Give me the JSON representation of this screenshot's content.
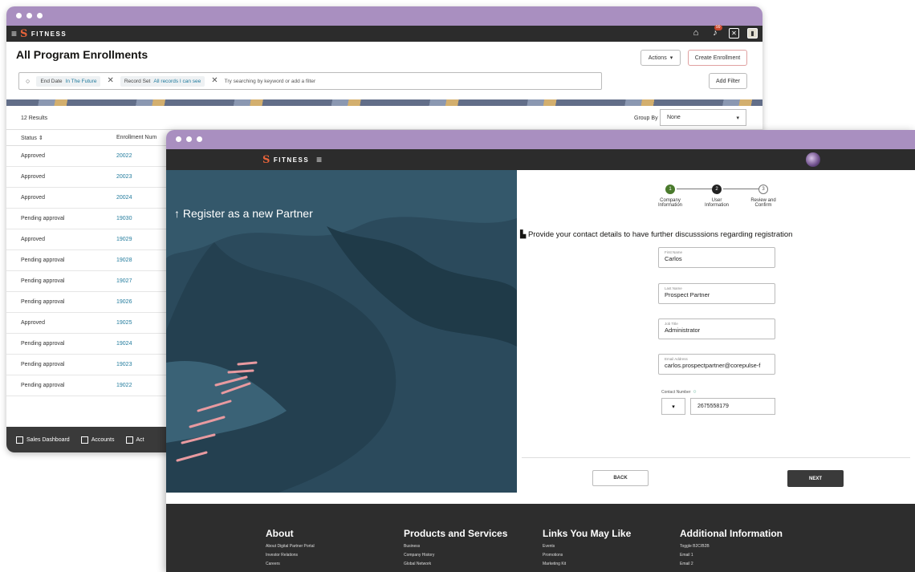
{
  "back_window": {
    "brand": "FITNESS",
    "notification_count": "99",
    "page_title": "All Program Enrollments",
    "actions_label": "Actions",
    "create_label": "Create Enrollment",
    "add_filter_label": "Add Filter",
    "filters": [
      {
        "name": "End Date",
        "value": "In The Future"
      },
      {
        "name": "Record Set",
        "value": "All records I can see"
      }
    ],
    "search_placeholder": "Try searching by keyword or add a filter",
    "results_count": "12 Results",
    "group_by_label": "Group By",
    "group_by_value": "None",
    "columns": [
      "Status",
      "Enrollment Num"
    ],
    "rows": [
      {
        "status": "Approved",
        "number": "20022"
      },
      {
        "status": "Approved",
        "number": "20023"
      },
      {
        "status": "Approved",
        "number": "20024"
      },
      {
        "status": "Pending approval",
        "number": "19030"
      },
      {
        "status": "Approved",
        "number": "19029"
      },
      {
        "status": "Pending approval",
        "number": "19028"
      },
      {
        "status": "Pending approval",
        "number": "19027"
      },
      {
        "status": "Pending approval",
        "number": "19026"
      },
      {
        "status": "Approved",
        "number": "19025"
      },
      {
        "status": "Pending approval",
        "number": "19024"
      },
      {
        "status": "Pending approval",
        "number": "19023"
      },
      {
        "status": "Pending approval",
        "number": "19022"
      }
    ],
    "bottom_nav": [
      "Sales Dashboard",
      "Accounts",
      "Act"
    ]
  },
  "front_window": {
    "brand": "FITNESS",
    "hero_title": "↑ Register as a new Partner",
    "steps": [
      {
        "num": "1",
        "line1": "Company",
        "line2": "Information"
      },
      {
        "num": "2",
        "line1": "User",
        "line2": "Information"
      },
      {
        "num": "3",
        "line1": "Review and",
        "line2": "Confirm"
      }
    ],
    "form_description": "Provide your contact details to have further discusssions regarding registration",
    "fields": [
      {
        "label": "First Name",
        "value": "Carlos"
      },
      {
        "label": "Last Name",
        "value": "Prospect Partner"
      },
      {
        "label": "Job Title",
        "value": "Administrator"
      },
      {
        "label": "Email Address",
        "value": "carlos.prospectpartner@corepulse-f"
      }
    ],
    "contact_label": "Contact Number",
    "phone_value": "2675558179",
    "back_label": "BACK",
    "next_label": "NEXT",
    "footer": [
      {
        "title": "About",
        "links": [
          "About Digital Partner Portal",
          "Investor Relations",
          "Careers"
        ]
      },
      {
        "title": "Products and Services",
        "links": [
          "Business",
          "Company History",
          "Global Network"
        ]
      },
      {
        "title": "Links You May Like",
        "links": [
          "Events",
          "Promotions",
          "Marketing Kit"
        ]
      },
      {
        "title": "Additional Information",
        "links": [
          "Toggle B2C/B2B",
          "Email 1",
          "Email 2"
        ]
      }
    ]
  },
  "colors": {
    "accent": "#217b9d",
    "chrome": "#a98fc0",
    "brand_mark": "#e8643a",
    "hero": "#2b4a5c",
    "step_done": "#4a7a2c"
  }
}
